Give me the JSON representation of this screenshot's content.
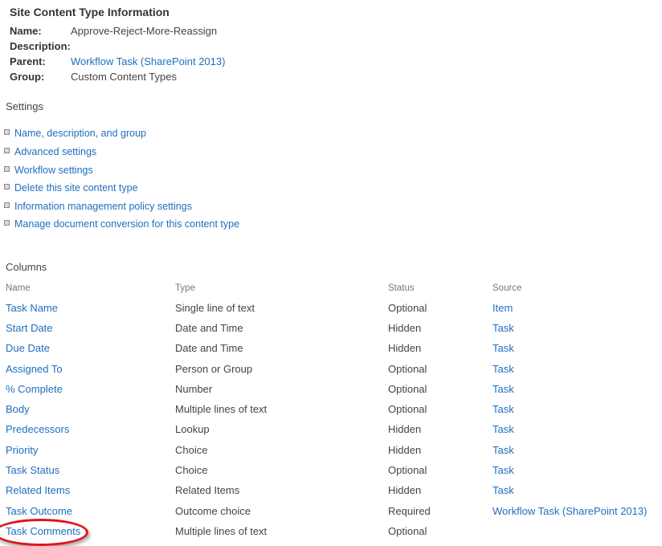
{
  "info": {
    "title": "Site Content Type Information",
    "name_label": "Name:",
    "name_value": "Approve-Reject-More-Reassign",
    "description_label": "Description:",
    "description_value": "",
    "parent_label": "Parent:",
    "parent_value": "Workflow Task (SharePoint 2013)",
    "group_label": "Group:",
    "group_value": "Custom Content Types"
  },
  "settings": {
    "title": "Settings",
    "items": [
      {
        "label": "Name, description, and group"
      },
      {
        "label": "Advanced settings"
      },
      {
        "label": "Workflow settings"
      },
      {
        "label": "Delete this site content type"
      },
      {
        "label": "Information management policy settings"
      },
      {
        "label": "Manage document conversion for this content type"
      }
    ]
  },
  "columns": {
    "title": "Columns",
    "headers": {
      "name": "Name",
      "type": "Type",
      "status": "Status",
      "source": "Source"
    },
    "rows": [
      {
        "name": "Task Name",
        "type": "Single line of text",
        "status": "Optional",
        "source": "Item"
      },
      {
        "name": "Start Date",
        "type": "Date and Time",
        "status": "Hidden",
        "source": "Task"
      },
      {
        "name": "Due Date",
        "type": "Date and Time",
        "status": "Hidden",
        "source": "Task"
      },
      {
        "name": "Assigned To",
        "type": "Person or Group",
        "status": "Optional",
        "source": "Task"
      },
      {
        "name": "% Complete",
        "type": "Number",
        "status": "Optional",
        "source": "Task"
      },
      {
        "name": "Body",
        "type": "Multiple lines of text",
        "status": "Optional",
        "source": "Task"
      },
      {
        "name": "Predecessors",
        "type": "Lookup",
        "status": "Hidden",
        "source": "Task"
      },
      {
        "name": "Priority",
        "type": "Choice",
        "status": "Hidden",
        "source": "Task"
      },
      {
        "name": "Task Status",
        "type": "Choice",
        "status": "Optional",
        "source": "Task"
      },
      {
        "name": "Related Items",
        "type": "Related Items",
        "status": "Hidden",
        "source": "Task"
      },
      {
        "name": "Task Outcome",
        "type": "Outcome choice",
        "status": "Required",
        "source": "Workflow Task (SharePoint 2013)"
      },
      {
        "name": "Task Comments",
        "type": "Multiple lines of text",
        "status": "Optional",
        "source": ""
      }
    ]
  },
  "annotation": {
    "highlighted_row": "Task Comments",
    "color": "#e0141e"
  }
}
